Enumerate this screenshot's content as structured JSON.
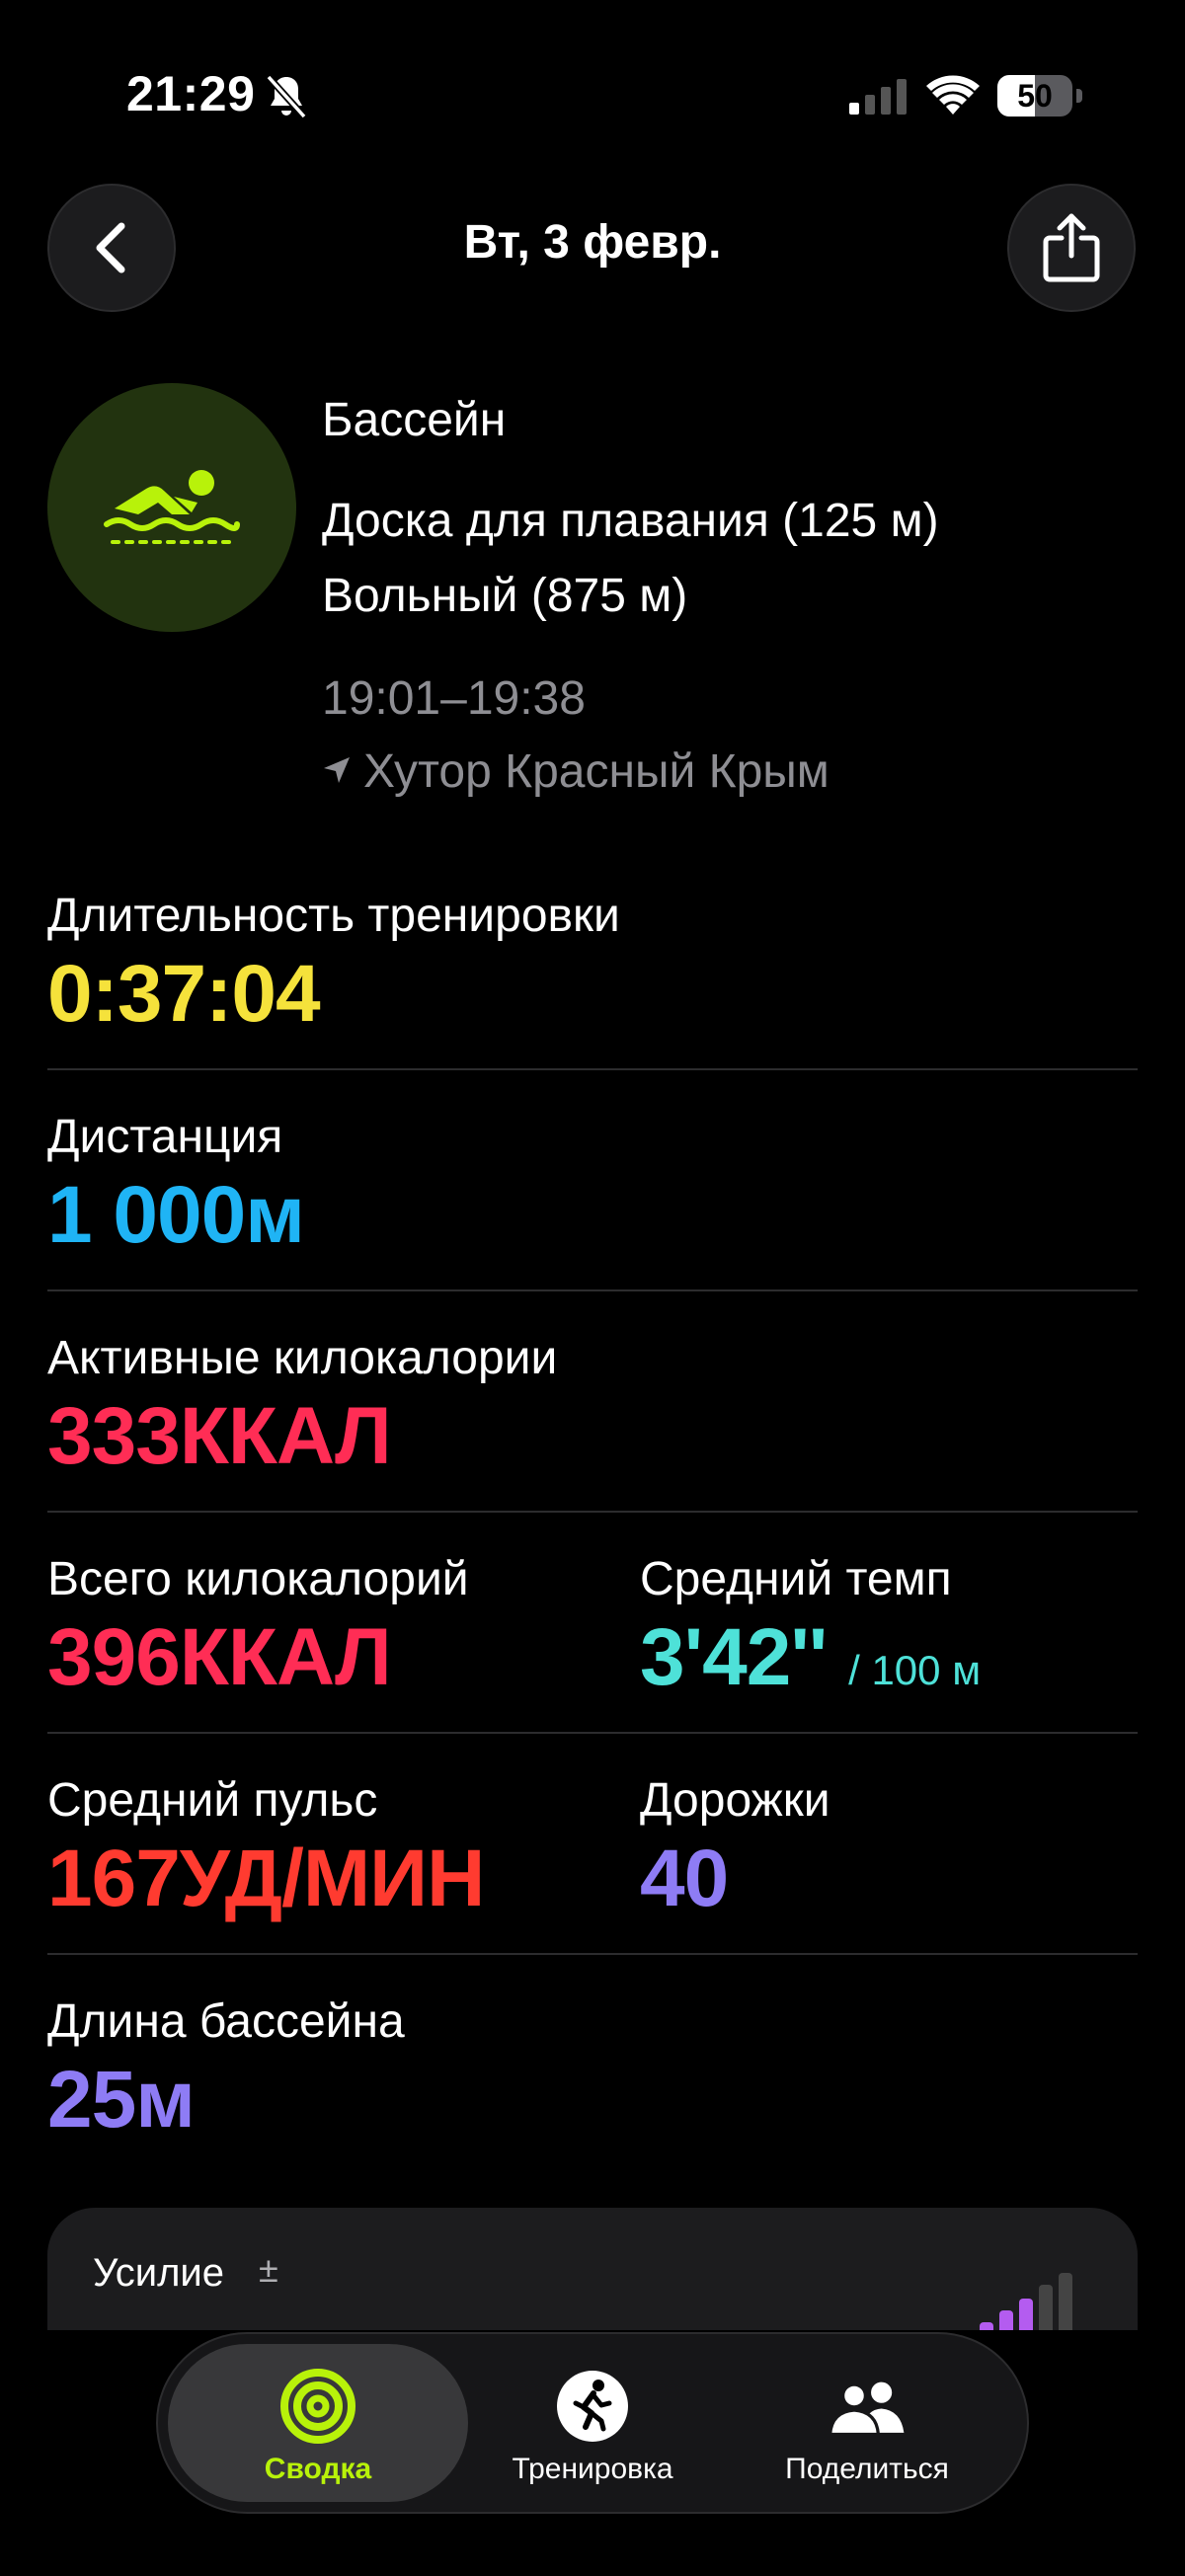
{
  "status_bar": {
    "time": "21:29",
    "battery_level": "50",
    "battery_fraction": 0.5,
    "icons": [
      "bell-slash-icon",
      "cellular-signal-icon",
      "wifi-icon",
      "battery-icon"
    ]
  },
  "header": {
    "title": "Вт, 3 февр.",
    "back_icon": "chevron-left-icon",
    "share_icon": "share-icon"
  },
  "workout": {
    "icon": "swimming-icon",
    "type": "Бассейн",
    "segments": [
      "Доска для плавания (125 м)",
      "Вольный (875 м)"
    ],
    "time_range": "19:01–19:38",
    "location": "Хутор Красный Крым"
  },
  "metrics": {
    "duration": {
      "label": "Длительность тренировки",
      "value": "0:37:04"
    },
    "distance": {
      "label": "Дистанция",
      "value": "1 000м"
    },
    "active_kcal": {
      "label": "Активные килокалории",
      "value": "333ККАЛ"
    },
    "total_kcal": {
      "label": "Всего килокалорий",
      "value": "396ККАЛ"
    },
    "avg_pace": {
      "label": "Средний темп",
      "value": "3'42''",
      "unit": "/ 100 м"
    },
    "avg_hr": {
      "label": "Средний пульс",
      "value": "167УД/МИН"
    },
    "lanes": {
      "label": "Дорожки",
      "value": "40"
    },
    "pool_length": {
      "label": "Длина бассейна",
      "value": "25м"
    }
  },
  "effort": {
    "label": "Усилие",
    "symbol": "±"
  },
  "tabs": [
    {
      "label": "Сводка",
      "icon": "activity-rings-icon",
      "active": true
    },
    {
      "label": "Тренировка",
      "icon": "running-figure-icon",
      "active": false
    },
    {
      "label": "Поделиться",
      "icon": "people-icon",
      "active": false
    }
  ],
  "colors": {
    "duration": "#f5e23b",
    "distance": "#1fb4f5",
    "kcal": "#ff2d55",
    "pace": "#4ee1d8",
    "heart_rate": "#ff3b30",
    "lanes": "#8e7cf5",
    "accent_green": "#b8f20a"
  }
}
